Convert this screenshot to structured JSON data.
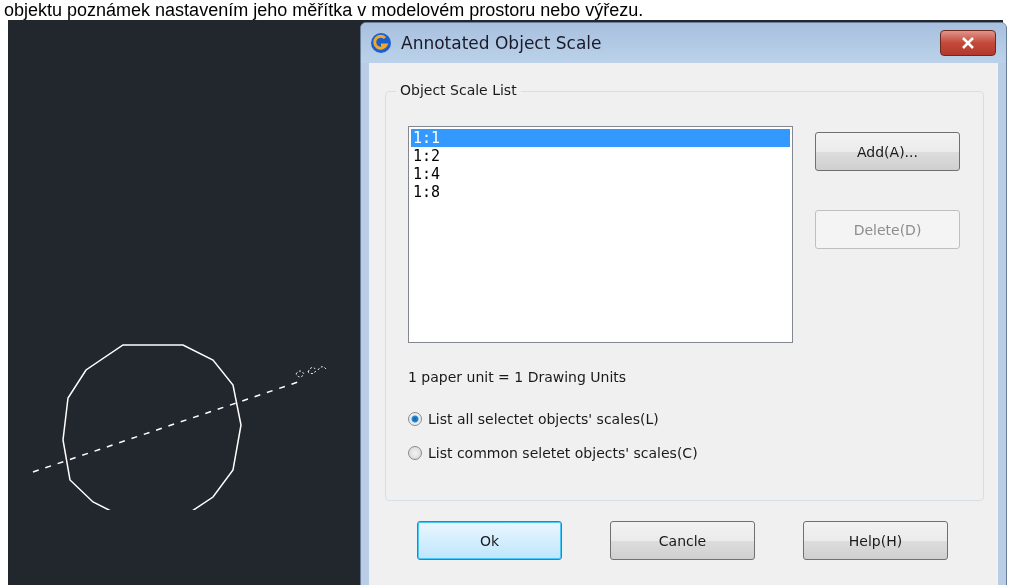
{
  "caption": "objektu poznámek nastavením jeho měřítka v modelovém prostoru nebo výřezu.",
  "dialog": {
    "title": "Annotated Object Scale",
    "group": {
      "label": "Object Scale List",
      "scales": [
        {
          "label": "1:1",
          "selected": true
        },
        {
          "label": "1:2",
          "selected": false
        },
        {
          "label": "1:4",
          "selected": false
        },
        {
          "label": "1:8",
          "selected": false
        }
      ],
      "side_buttons": [
        {
          "label": "Add(A)...",
          "disabled": false
        },
        {
          "label": "Delete(D)",
          "disabled": true
        }
      ],
      "units_text": "1 paper unit = 1 Drawing Units",
      "options": [
        {
          "label": "List all selectet objects' scales(L)",
          "selected": true
        },
        {
          "label": "List common seletet objects' scales(C)",
          "selected": false
        }
      ]
    },
    "buttons": [
      {
        "label": "Ok",
        "default": true
      },
      {
        "label": "Cancle",
        "default": false
      },
      {
        "label": "Help(H)",
        "default": false
      }
    ]
  }
}
